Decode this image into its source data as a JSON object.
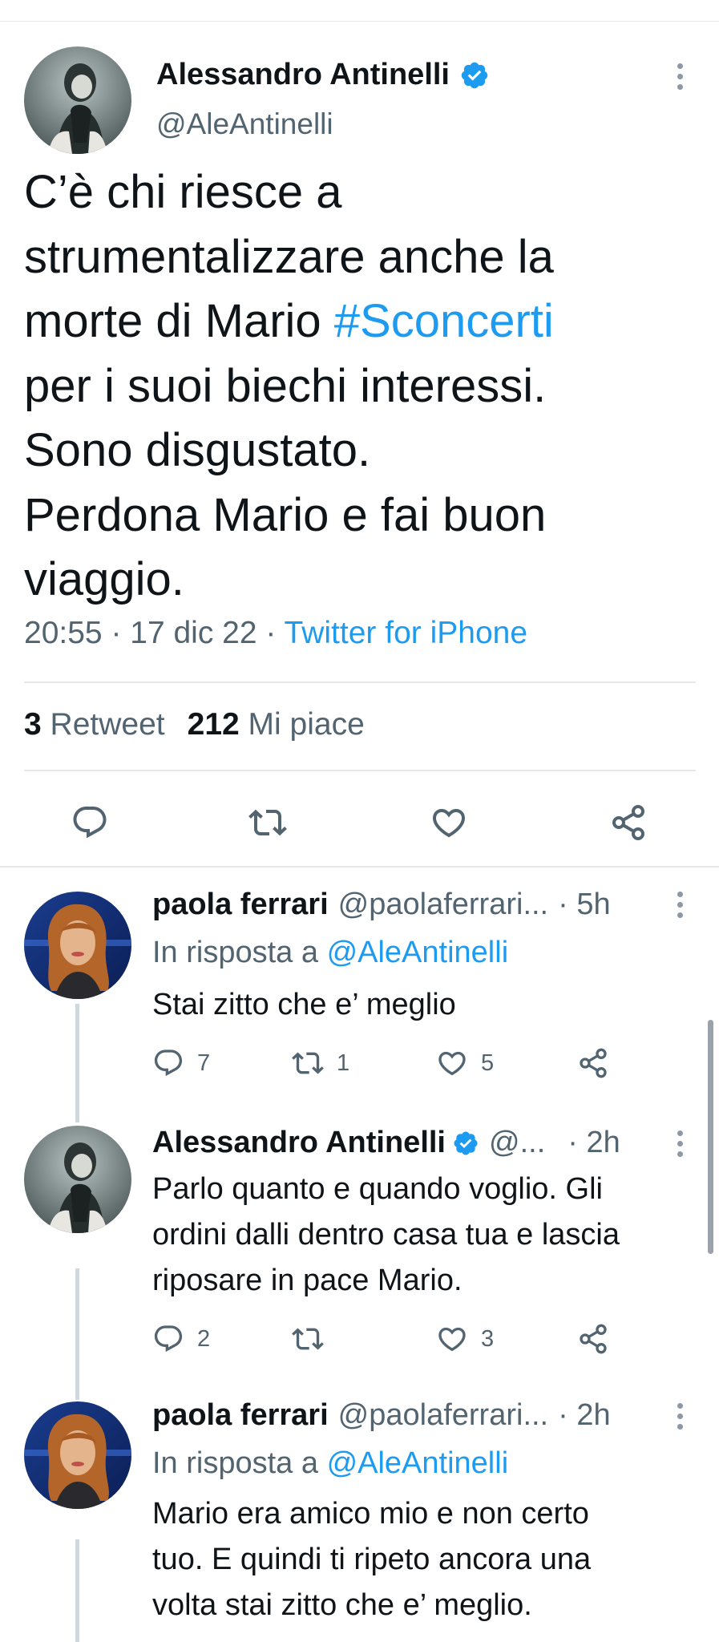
{
  "main_tweet": {
    "author_name": "Alessandro Antinelli",
    "author_handle": "@AleAntinelli",
    "text_lines": [
      "C’è chi riesce a",
      "strumentalizzare anche la",
      "morte di Mario ",
      "per i suoi biechi interessi.",
      "Sono disgustato.",
      "Perdona Mario e fai buon",
      "viaggio."
    ],
    "hashtag": "#Sconcerti",
    "time": "20:55",
    "date": "17 dic 22",
    "separator": " · ",
    "source": "Twitter for iPhone",
    "retweet_count": "3",
    "retweet_label": "Retweet",
    "like_count": "212",
    "like_label": "Mi piace"
  },
  "replies": [
    {
      "author_name": "paola ferrari",
      "author_handle": "@paolaferrari...",
      "time": "· 5h",
      "reply_prefix": "In risposta a ",
      "reply_to": "@AleAntinelli",
      "text_lines": [
        "Stai zitto che e’ meglio"
      ],
      "reply_count": "7",
      "retweet_count": "1",
      "like_count": "5"
    },
    {
      "author_name": "Alessandro Antinelli",
      "author_handle": "@...",
      "time": "· 2h",
      "text_lines": [
        "Parlo quanto e quando voglio. Gli",
        "ordini dalli dentro casa tua e lascia",
        "riposare in pace Mario."
      ],
      "reply_count": "2",
      "retweet_count": "",
      "like_count": "3"
    },
    {
      "author_name": "paola ferrari",
      "author_handle": "@paolaferrari...",
      "time": "· 2h",
      "reply_prefix": "In risposta a ",
      "reply_to": "@AleAntinelli",
      "text_lines": [
        "Mario era amico mio e non certo",
        "tuo. E quindi ti ripeto ancora una",
        "volta stai zitto che e’ meglio."
      ]
    }
  ],
  "colors": {
    "link": "#1d9bf0",
    "secondary_text": "#536471",
    "primary_text": "#0f1419",
    "separator": "#e6e9ec",
    "thread_line": "#cfd9de"
  }
}
